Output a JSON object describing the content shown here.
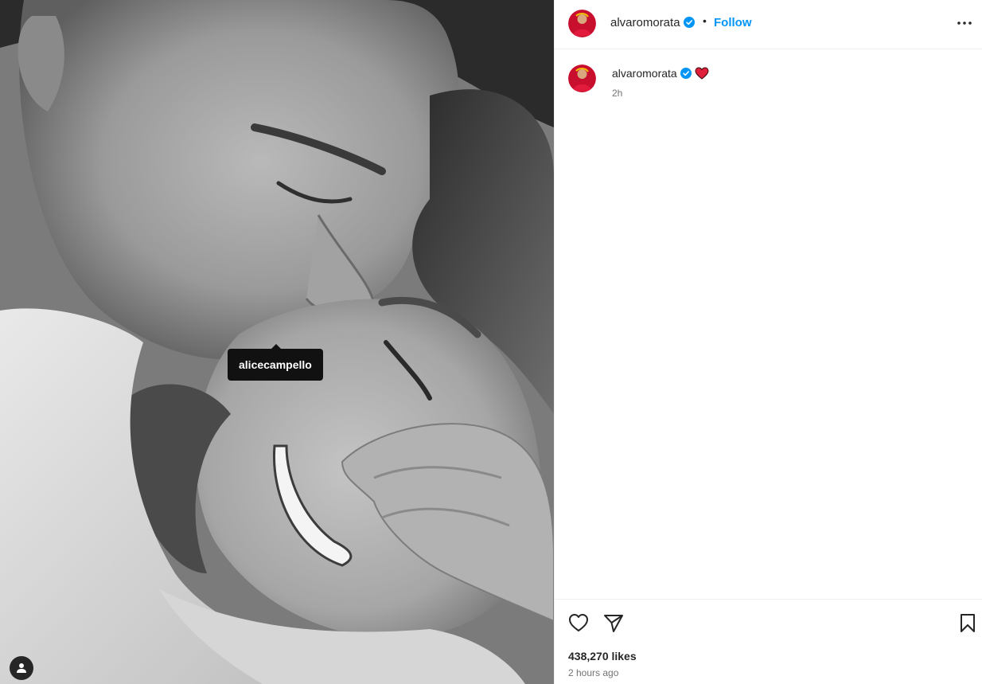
{
  "photo": {
    "tag_tooltip": "alicecampello",
    "tagged_icon": "user-icon"
  },
  "header": {
    "username": "alvaromorata",
    "separator": "•",
    "follow_label": "Follow",
    "verified_icon": "verified-badge-icon",
    "more_icon": "more-options-icon"
  },
  "caption": {
    "username": "alvaromorata",
    "emoji": "heart-emoji",
    "time": "2h"
  },
  "actions": {
    "like_icon": "heart-outline-icon",
    "share_icon": "paper-plane-icon",
    "save_icon": "bookmark-icon",
    "likes": "438,270 likes",
    "posted": "2 hours ago"
  },
  "colors": {
    "link": "#0095f6",
    "verified": "#0095f6",
    "heart": "#ff3040",
    "text": "#262626",
    "muted": "#737373"
  }
}
